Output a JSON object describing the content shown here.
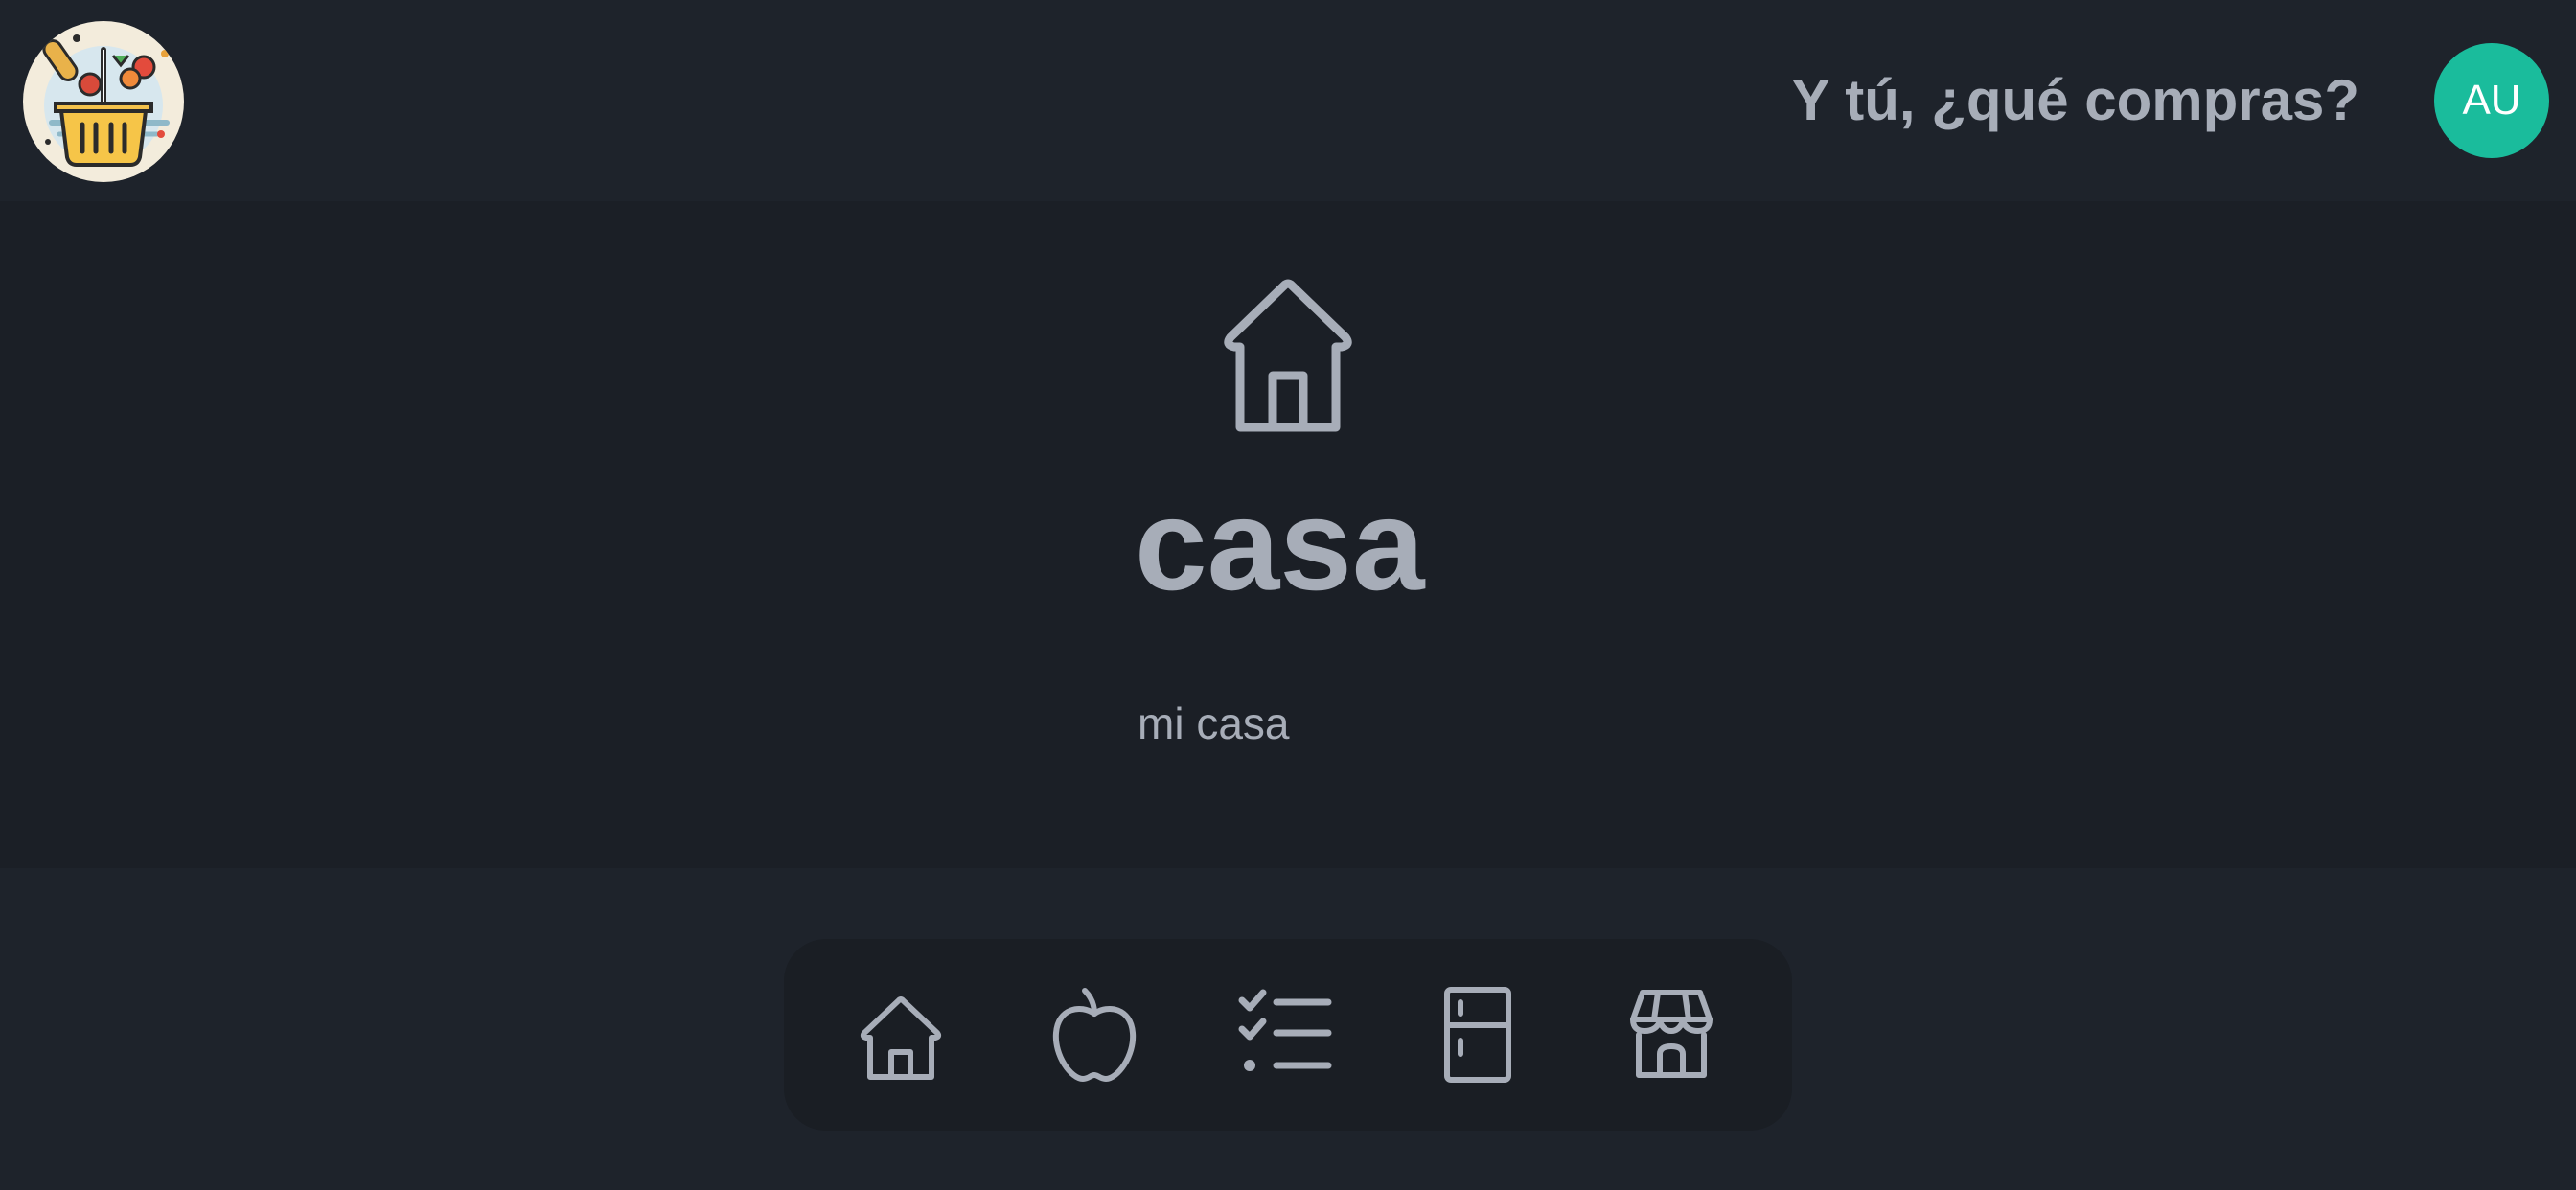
{
  "header": {
    "logo_icon": "grocery-basket-logo",
    "title": "Y tú, ¿qué compras?",
    "avatar_initials": "AU",
    "avatar_color": "#1abc9c"
  },
  "main": {
    "icon": "house-icon",
    "place_name": "casa",
    "place_description": "mi casa"
  },
  "nav": {
    "items": [
      {
        "icon": "house-icon"
      },
      {
        "icon": "apple-icon"
      },
      {
        "icon": "checklist-icon"
      },
      {
        "icon": "fridge-icon"
      },
      {
        "icon": "store-icon"
      }
    ]
  },
  "colors": {
    "text": "#a7adb8",
    "header_bg": "#1e232b",
    "main_bg": "#1b1f26",
    "nav_bg": "#1a1e24"
  }
}
